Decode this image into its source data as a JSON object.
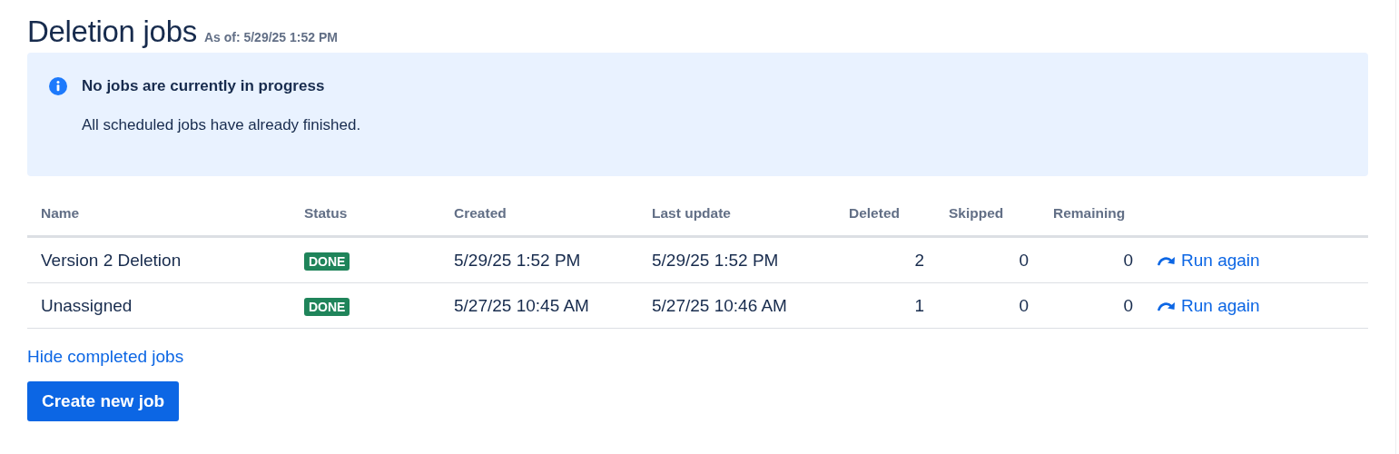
{
  "title": "Deletion jobs",
  "as_of": "As of: 5/29/25 1:52 PM",
  "notice": {
    "kind": "info",
    "heading": "No jobs are currently in progress",
    "message": "All scheduled jobs have already finished."
  },
  "table": {
    "columns": [
      "Name",
      "Status",
      "Created",
      "Last update",
      "Deleted",
      "Skipped",
      "Remaining"
    ],
    "rows": [
      {
        "name": "Version 2 Deletion",
        "status": "DONE",
        "color": "#1f845a",
        "created": "5/29/25 1:52 PM",
        "last_update": "5/29/25 1:52 PM",
        "deleted": "2",
        "skipped": "0",
        "remaining": "0",
        "action": "Run again"
      },
      {
        "name": "Unassigned",
        "status": "DONE",
        "color": "#1f845a",
        "created": "5/27/25 10:45 AM",
        "last_update": "5/27/25 10:46 AM",
        "deleted": "1",
        "skipped": "0",
        "remaining": "0",
        "action": "Run again"
      }
    ]
  },
  "toggle_link": "Hide completed jobs",
  "create_button": "Create new job"
}
